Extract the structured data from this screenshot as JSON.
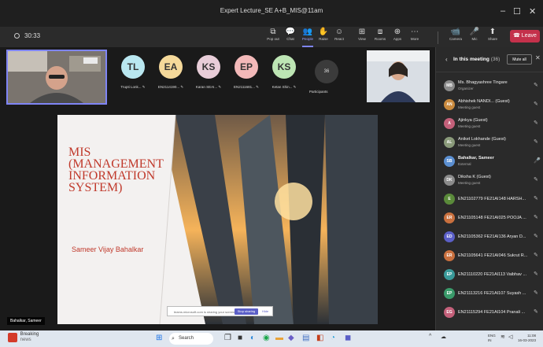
{
  "window": {
    "title": "Expert Lecture_SE A+B_MIS@11am",
    "minimize": "–",
    "maximize": "☐",
    "close": "✕"
  },
  "toolbar": {
    "timer": "30:33",
    "buttons": [
      {
        "label": "Pop out",
        "icon": "⧉"
      },
      {
        "label": "Chat",
        "icon": "💬"
      },
      {
        "label": "People",
        "icon": "👥",
        "active": true
      },
      {
        "label": "Raise",
        "icon": "✋"
      },
      {
        "label": "React",
        "icon": "☺"
      },
      {
        "label": "View",
        "icon": "⊞"
      },
      {
        "label": "Rooms",
        "icon": "⧈"
      },
      {
        "label": "Apps",
        "icon": "⊕"
      },
      {
        "label": "More",
        "icon": "⋯"
      },
      {
        "label": "Camera",
        "icon": "📹"
      },
      {
        "label": "Mic",
        "icon": "🎤"
      },
      {
        "label": "Share",
        "icon": "⬆"
      }
    ],
    "leave": "Leave"
  },
  "participants_strip": [
    {
      "initials": "TL",
      "name": "Trupti Lonk...",
      "color": "#b9e7f0"
    },
    {
      "initials": "EA",
      "name": "EN2114190...",
      "color": "#f5d99a"
    },
    {
      "initials": "KS",
      "name": "Karan SEAI...",
      "color": "#e8cdd8"
    },
    {
      "initials": "EP",
      "name": "EN2111681...",
      "color": "#f3b9b9"
    },
    {
      "initials": "KS",
      "name": "Ketan Shin...",
      "color": "#bde5b4"
    }
  ],
  "participants_count": "36",
  "participants_label": "Participants",
  "slide": {
    "title_lines": [
      "MIS",
      "(MANAGEMENT",
      "INFORMATION",
      "SYSTEM)"
    ],
    "author": "Sameer Vijay Bahalkar",
    "accent_color": "#c0392b"
  },
  "share_bar": {
    "text": "teams.microsoft.com is sharing your screen.",
    "stop_label": "Stop sharing",
    "hide_label": "Hide"
  },
  "presenter_name": "Bahalkar, Sameer",
  "panel": {
    "title": "In this meeting",
    "count": "(36)",
    "mute_all": "Mute all",
    "people": [
      {
        "initials": "MB",
        "name": "Ms. Bhagyashree Tingare",
        "role": "Organizer",
        "color": "#8a8a8a"
      },
      {
        "initials": "AN",
        "name": "Abhishek NANDI... (Guest)",
        "role": "Meeting guest",
        "color": "#c98a3e"
      },
      {
        "initials": "A",
        "name": "Ajinkya (Guest)",
        "role": "Meeting guest",
        "color": "#c4607a"
      },
      {
        "initials": "AL",
        "name": "Aniket Lokhande (Guest)",
        "role": "Meeting guest",
        "color": "#8a9a7a"
      },
      {
        "initials": "SB",
        "name": "Bahalkar, Sameer",
        "role": "External",
        "color": "#5b8fd1",
        "bold": true
      },
      {
        "initials": "DK",
        "name": "Diksha K (Guest)",
        "role": "Meeting guest",
        "color": "#8a8a8a"
      },
      {
        "initials": "E",
        "name": "EN21102779 FE21AI148 HARSH...",
        "role": "",
        "color": "#5a8a3a"
      },
      {
        "initials": "ER",
        "name": "EN21105148 FE21AI025 POOJA ...",
        "role": "",
        "color": "#c9703e"
      },
      {
        "initials": "ED",
        "name": "EN21105362 FE21AI136 Aryan D...",
        "role": "",
        "color": "#5b5fc7"
      },
      {
        "initials": "ER",
        "name": "EN21105641 FE21AI046 Sukrut R...",
        "role": "",
        "color": "#c9703e"
      },
      {
        "initials": "EP",
        "name": "EN21110220 FE21AI113 Vaibhav ...",
        "role": "",
        "color": "#3a9a9a"
      },
      {
        "initials": "EP",
        "name": "EN21113216 FE21AI107 Suyash ...",
        "role": "",
        "color": "#3a9a6a"
      },
      {
        "initials": "EG",
        "name": "EN21115294 FE21AI104 Pranali ...",
        "role": "",
        "color": "#c4607a"
      }
    ]
  },
  "taskbar": {
    "news_title": "Breaking",
    "news_sub": "news",
    "search": "Search",
    "lang": "ENG",
    "lang2": "IN",
    "time": "11:08",
    "date": "16-03-2023"
  }
}
